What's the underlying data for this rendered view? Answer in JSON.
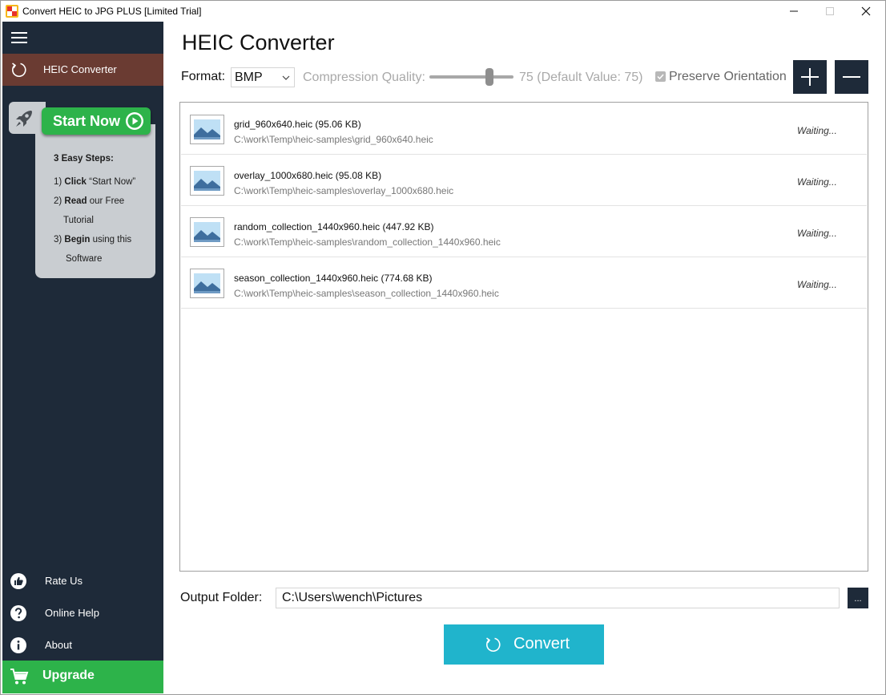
{
  "window": {
    "title": "Convert HEIC to JPG PLUS [Limited Trial]"
  },
  "sidebar": {
    "active_item": {
      "label": "HEIC Converter",
      "icon": "refresh-icon"
    },
    "promo": {
      "start_now_label": "Start Now",
      "steps_title": "3 Easy Steps:",
      "step1_prefix": "1) ",
      "step1_bold": "Click",
      "step1_text": " “Start Now”",
      "step2_prefix": "2) ",
      "step2_bold": "Read",
      "step2_text": " our Free",
      "step2_cont": "Tutorial",
      "step3_prefix": "3) ",
      "step3_bold": "Begin",
      "step3_text": " using this",
      "step3_cont": "Software"
    },
    "links": [
      {
        "label": "Rate Us",
        "icon": "thumbs-up-icon"
      },
      {
        "label": "Online Help",
        "icon": "question-icon"
      },
      {
        "label": "About",
        "icon": "info-icon"
      }
    ],
    "upgrade_label": "Upgrade"
  },
  "main": {
    "title": "HEIC Converter",
    "format_label": "Format:",
    "format_value": "BMP",
    "quality_label": "Compression Quality:",
    "quality_value": 75,
    "quality_text": "75 (Default Value: 75)",
    "preserve_label": "Preserve Orientation",
    "preserve_checked": true
  },
  "files": [
    {
      "name": "grid_960x640.heic (95.06 KB)",
      "path": "C:\\work\\Temp\\heic-samples\\grid_960x640.heic",
      "status": "Waiting..."
    },
    {
      "name": "overlay_1000x680.heic (95.08 KB)",
      "path": "C:\\work\\Temp\\heic-samples\\overlay_1000x680.heic",
      "status": "Waiting..."
    },
    {
      "name": "random_collection_1440x960.heic (447.92 KB)",
      "path": "C:\\work\\Temp\\heic-samples\\random_collection_1440x960.heic",
      "status": "Waiting..."
    },
    {
      "name": "season_collection_1440x960.heic (774.68 KB)",
      "path": "C:\\work\\Temp\\heic-samples\\season_collection_1440x960.heic",
      "status": "Waiting..."
    }
  ],
  "output": {
    "label": "Output Folder:",
    "value": "C:\\Users\\wench\\Pictures",
    "browse_label": "..."
  },
  "convert_label": "Convert",
  "colors": {
    "sidebar_bg": "#1e2a39",
    "active_item_bg": "#6a3b32",
    "green": "#2db34a",
    "convert_bg": "#20b4cc"
  }
}
